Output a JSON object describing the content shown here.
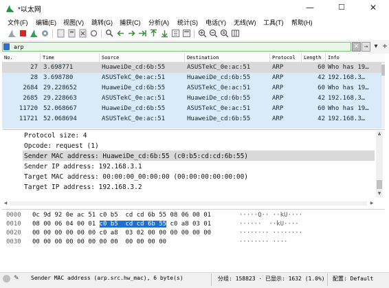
{
  "window": {
    "title": "*以太网",
    "minimize": "—",
    "maximize": "☐",
    "close": "✕"
  },
  "menu": [
    "文件(F)",
    "编辑(E)",
    "视图(V)",
    "跳转(G)",
    "捕获(C)",
    "分析(A)",
    "统计(S)",
    "电话(Y)",
    "无线(W)",
    "工具(T)",
    "帮助(H)"
  ],
  "toolbar": {
    "icons": [
      "shark-fin-start-icon",
      "stop-square-icon",
      "restart-icon",
      "options-gear-icon",
      "open-file-icon",
      "save-file-icon",
      "close-file-icon",
      "reload-icon",
      "find-packet-icon",
      "go-back-icon",
      "go-forward-icon",
      "go-to-packet-icon",
      "go-first-icon",
      "go-last-icon",
      "auto-scroll-icon",
      "colorize-icon",
      "zoom-in-icon",
      "zoom-out-icon",
      "zoom-normal-icon",
      "resize-columns-icon"
    ]
  },
  "filter": {
    "value": "arp",
    "clear_label": "✕",
    "apply_label": "→",
    "expression_label": "▾",
    "add_label": "+"
  },
  "packet_list": {
    "columns": [
      "No.",
      "Time",
      "Source",
      "Destination",
      "Protocol",
      "Length",
      "Info"
    ],
    "rows": [
      {
        "no": "27",
        "time": "3.698771",
        "source": "HuaweiDe_cd:6b:55",
        "destination": "ASUSTekC_0e:ac:51",
        "protocol": "ARP",
        "length": "60",
        "info": "Who has 19…",
        "selected": true
      },
      {
        "no": "28",
        "time": "3.698780",
        "source": "ASUSTekC_0e:ac:51",
        "destination": "HuaweiDe_cd:6b:55",
        "protocol": "ARP",
        "length": "42",
        "info": "192.168.3…",
        "selected": false
      },
      {
        "no": "2684",
        "time": "29.228652",
        "source": "HuaweiDe_cd:6b:55",
        "destination": "ASUSTekC_0e:ac:51",
        "protocol": "ARP",
        "length": "60",
        "info": "Who has 19…",
        "selected": false
      },
      {
        "no": "2685",
        "time": "29.228663",
        "source": "ASUSTekC_0e:ac:51",
        "destination": "HuaweiDe_cd:6b:55",
        "protocol": "ARP",
        "length": "42",
        "info": "192.168.3…",
        "selected": false
      },
      {
        "no": "11720",
        "time": "52.068667",
        "source": "HuaweiDe_cd:6b:55",
        "destination": "ASUSTekC_0e:ac:51",
        "protocol": "ARP",
        "length": "60",
        "info": "Who has 19…",
        "selected": false
      },
      {
        "no": "11721",
        "time": "52.068694",
        "source": "ASUSTekC_0e:ac:51",
        "destination": "HuaweiDe_cd:6b:55",
        "protocol": "ARP",
        "length": "42",
        "info": "192.168.3…",
        "selected": false
      }
    ]
  },
  "details": [
    "Protocol size: 4",
    "Opcode: request (1)",
    "Sender MAC address: HuaweiDe_cd:6b:55 (c0:b5:cd:cd:6b:55)",
    "Sender IP address: 192.168.3.1",
    "Target MAC address: 00:00:00_00:00:00 (00:00:00:00:00:00)",
    "Target IP address: 192.168.3.2"
  ],
  "bytes": [
    {
      "offset": "0000",
      "pre": "0c 9d 92 0e ac 51 c0 b5  cd cd 6b 55 08 06 00 01",
      "hl": "",
      "post": "",
      "ascii": "·····Q·· ··kU····"
    },
    {
      "offset": "0010",
      "pre": "08 00 06 04 00 01 ",
      "hl": "c0 b5  cd cd 6b 55",
      "post": " c0 a8 03 01",
      "ascii": "······  ··kU····"
    },
    {
      "offset": "0020",
      "pre": "00 00 00 00 00 00 c0 a8  03 02 00 00 00 00 00 00",
      "hl": "",
      "post": "",
      "ascii": "········ ········"
    },
    {
      "offset": "0030",
      "pre": "00 00 00 00 00 00 00 00  00 00 00 00",
      "hl": "",
      "post": "",
      "ascii": "········ ····"
    }
  ],
  "status": {
    "field": "Sender MAC address (arp.src.hw_mac), 6 byte(s)",
    "packets": "分组: 158823 · 已显示: 1632 (1.0%)",
    "profile": "配置: Default"
  },
  "colors": {
    "row_arp": "#dbeaf8",
    "row_selected": "#d9d9d9",
    "byte_highlight": "#1f6fd2",
    "filter_valid": "#e8f6e8"
  }
}
